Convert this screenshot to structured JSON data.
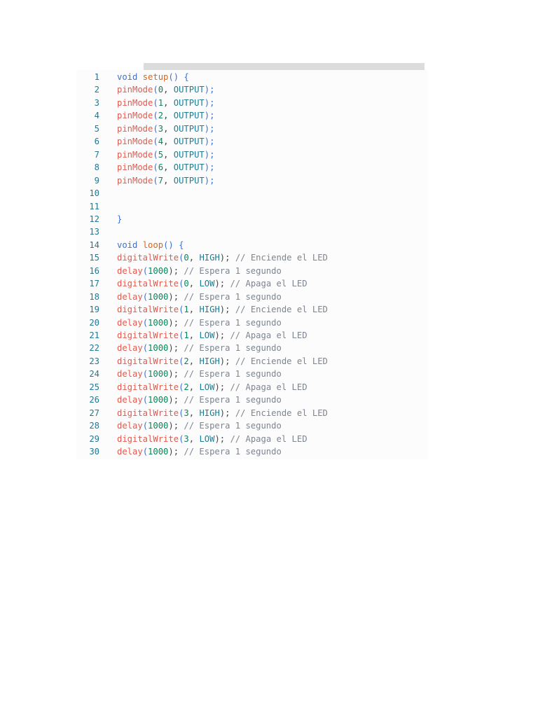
{
  "code": {
    "lines": [
      {
        "n": "1",
        "tokens": [
          {
            "t": "void",
            "c": "kw"
          },
          {
            "t": " ",
            "c": "plain"
          },
          {
            "t": "setup",
            "c": "fn"
          },
          {
            "t": "() {",
            "c": "punc"
          }
        ]
      },
      {
        "n": "2",
        "tokens": [
          {
            "t": "pinMode",
            "c": "err"
          },
          {
            "t": "(",
            "c": "punc"
          },
          {
            "t": "0",
            "c": "num"
          },
          {
            "t": ", ",
            "c": "plain"
          },
          {
            "t": "OUTPUT",
            "c": "const"
          },
          {
            "t": ");",
            "c": "punc"
          }
        ]
      },
      {
        "n": "3",
        "tokens": [
          {
            "t": "pinMode",
            "c": "err"
          },
          {
            "t": "(",
            "c": "punc"
          },
          {
            "t": "1",
            "c": "num"
          },
          {
            "t": ", ",
            "c": "plain"
          },
          {
            "t": "OUTPUT",
            "c": "const"
          },
          {
            "t": ");",
            "c": "punc"
          }
        ]
      },
      {
        "n": "4",
        "tokens": [
          {
            "t": "pinMode",
            "c": "err"
          },
          {
            "t": "(",
            "c": "punc"
          },
          {
            "t": "2",
            "c": "num"
          },
          {
            "t": ", ",
            "c": "plain"
          },
          {
            "t": "OUTPUT",
            "c": "const"
          },
          {
            "t": ");",
            "c": "punc"
          }
        ]
      },
      {
        "n": "5",
        "tokens": [
          {
            "t": "pinMode",
            "c": "err"
          },
          {
            "t": "(",
            "c": "punc"
          },
          {
            "t": "3",
            "c": "num"
          },
          {
            "t": ", ",
            "c": "plain"
          },
          {
            "t": "OUTPUT",
            "c": "const"
          },
          {
            "t": ");",
            "c": "punc"
          }
        ]
      },
      {
        "n": "6",
        "tokens": [
          {
            "t": "pinMode",
            "c": "err"
          },
          {
            "t": "(",
            "c": "punc"
          },
          {
            "t": "4",
            "c": "num"
          },
          {
            "t": ", ",
            "c": "plain"
          },
          {
            "t": "OUTPUT",
            "c": "const"
          },
          {
            "t": ");",
            "c": "punc"
          }
        ]
      },
      {
        "n": "7",
        "tokens": [
          {
            "t": "pinMode",
            "c": "err"
          },
          {
            "t": "(",
            "c": "punc"
          },
          {
            "t": "5",
            "c": "num"
          },
          {
            "t": ", ",
            "c": "plain"
          },
          {
            "t": "OUTPUT",
            "c": "const"
          },
          {
            "t": ");",
            "c": "punc"
          }
        ]
      },
      {
        "n": "8",
        "tokens": [
          {
            "t": "pinMode",
            "c": "err"
          },
          {
            "t": "(",
            "c": "punc"
          },
          {
            "t": "6",
            "c": "num"
          },
          {
            "t": ", ",
            "c": "plain"
          },
          {
            "t": "OUTPUT",
            "c": "const"
          },
          {
            "t": ");",
            "c": "punc"
          }
        ]
      },
      {
        "n": "9",
        "tokens": [
          {
            "t": "pinMode",
            "c": "err"
          },
          {
            "t": "(",
            "c": "punc"
          },
          {
            "t": "7",
            "c": "num"
          },
          {
            "t": ", ",
            "c": "plain"
          },
          {
            "t": "OUTPUT",
            "c": "const"
          },
          {
            "t": ");",
            "c": "punc"
          }
        ]
      },
      {
        "n": "10",
        "tokens": []
      },
      {
        "n": "11",
        "tokens": []
      },
      {
        "n": "12",
        "tokens": [
          {
            "t": "}",
            "c": "punc"
          }
        ]
      },
      {
        "n": "13",
        "tokens": []
      },
      {
        "n": "14",
        "tokens": [
          {
            "t": "void",
            "c": "kw"
          },
          {
            "t": " ",
            "c": "plain"
          },
          {
            "t": "loop",
            "c": "fn"
          },
          {
            "t": "() {",
            "c": "punc"
          }
        ]
      },
      {
        "n": "15",
        "tokens": [
          {
            "t": "digitalWrite",
            "c": "err"
          },
          {
            "t": "(",
            "c": "punc"
          },
          {
            "t": "0",
            "c": "num"
          },
          {
            "t": ", ",
            "c": "plain"
          },
          {
            "t": "HIGH",
            "c": "const"
          },
          {
            "t": "); ",
            "c": "plain"
          },
          {
            "t": "// Enciende el LED",
            "c": "com"
          }
        ]
      },
      {
        "n": "16",
        "tokens": [
          {
            "t": "delay",
            "c": "err"
          },
          {
            "t": "(",
            "c": "punc"
          },
          {
            "t": "1000",
            "c": "num"
          },
          {
            "t": "); ",
            "c": "plain"
          },
          {
            "t": "// Espera 1 segundo",
            "c": "com"
          }
        ]
      },
      {
        "n": "17",
        "tokens": [
          {
            "t": "digitalWrite",
            "c": "err"
          },
          {
            "t": "(",
            "c": "punc"
          },
          {
            "t": "0",
            "c": "num"
          },
          {
            "t": ", ",
            "c": "plain"
          },
          {
            "t": "LOW",
            "c": "const"
          },
          {
            "t": "); ",
            "c": "plain"
          },
          {
            "t": "// Apaga el LED",
            "c": "com"
          }
        ]
      },
      {
        "n": "18",
        "tokens": [
          {
            "t": "delay",
            "c": "err"
          },
          {
            "t": "(",
            "c": "punc"
          },
          {
            "t": "1000",
            "c": "num"
          },
          {
            "t": "); ",
            "c": "plain"
          },
          {
            "t": "// Espera 1 segundo",
            "c": "com"
          }
        ]
      },
      {
        "n": "19",
        "tokens": [
          {
            "t": "digitalWrite",
            "c": "err"
          },
          {
            "t": "(",
            "c": "punc"
          },
          {
            "t": "1",
            "c": "num"
          },
          {
            "t": ", ",
            "c": "plain"
          },
          {
            "t": "HIGH",
            "c": "const"
          },
          {
            "t": "); ",
            "c": "plain"
          },
          {
            "t": "// Enciende el LED",
            "c": "com"
          }
        ]
      },
      {
        "n": "20",
        "tokens": [
          {
            "t": "delay",
            "c": "err"
          },
          {
            "t": "(",
            "c": "punc"
          },
          {
            "t": "1000",
            "c": "num"
          },
          {
            "t": "); ",
            "c": "plain"
          },
          {
            "t": "// Espera 1 segundo",
            "c": "com"
          }
        ]
      },
      {
        "n": "21",
        "tokens": [
          {
            "t": "digitalWrite",
            "c": "err"
          },
          {
            "t": "(",
            "c": "punc"
          },
          {
            "t": "1",
            "c": "num"
          },
          {
            "t": ", ",
            "c": "plain"
          },
          {
            "t": "LOW",
            "c": "const"
          },
          {
            "t": "); ",
            "c": "plain"
          },
          {
            "t": "// Apaga el LED",
            "c": "com"
          }
        ]
      },
      {
        "n": "22",
        "tokens": [
          {
            "t": "delay",
            "c": "err"
          },
          {
            "t": "(",
            "c": "punc"
          },
          {
            "t": "1000",
            "c": "num"
          },
          {
            "t": "); ",
            "c": "plain"
          },
          {
            "t": "// Espera 1 segundo",
            "c": "com"
          }
        ]
      },
      {
        "n": "23",
        "tokens": [
          {
            "t": "digitalWrite",
            "c": "err"
          },
          {
            "t": "(",
            "c": "punc"
          },
          {
            "t": "2",
            "c": "num"
          },
          {
            "t": ", ",
            "c": "plain"
          },
          {
            "t": "HIGH",
            "c": "const"
          },
          {
            "t": "); ",
            "c": "plain"
          },
          {
            "t": "// Enciende el LED",
            "c": "com"
          }
        ]
      },
      {
        "n": "24",
        "tokens": [
          {
            "t": "delay",
            "c": "err"
          },
          {
            "t": "(",
            "c": "punc"
          },
          {
            "t": "1000",
            "c": "num"
          },
          {
            "t": "); ",
            "c": "plain"
          },
          {
            "t": "// Espera 1 segundo",
            "c": "com"
          }
        ]
      },
      {
        "n": "25",
        "tokens": [
          {
            "t": "digitalWrite",
            "c": "err"
          },
          {
            "t": "(",
            "c": "punc"
          },
          {
            "t": "2",
            "c": "num"
          },
          {
            "t": ", ",
            "c": "plain"
          },
          {
            "t": "LOW",
            "c": "const"
          },
          {
            "t": "); ",
            "c": "plain"
          },
          {
            "t": "// Apaga el LED",
            "c": "com"
          }
        ]
      },
      {
        "n": "26",
        "tokens": [
          {
            "t": "delay",
            "c": "err"
          },
          {
            "t": "(",
            "c": "punc"
          },
          {
            "t": "1000",
            "c": "num"
          },
          {
            "t": "); ",
            "c": "plain"
          },
          {
            "t": "// Espera 1 segundo",
            "c": "com"
          }
        ]
      },
      {
        "n": "27",
        "tokens": [
          {
            "t": "digitalWrite",
            "c": "err"
          },
          {
            "t": "(",
            "c": "punc"
          },
          {
            "t": "3",
            "c": "num"
          },
          {
            "t": ", ",
            "c": "plain"
          },
          {
            "t": "HIGH",
            "c": "const"
          },
          {
            "t": "); ",
            "c": "plain"
          },
          {
            "t": "// Enciende el LED",
            "c": "com"
          }
        ]
      },
      {
        "n": "28",
        "tokens": [
          {
            "t": "delay",
            "c": "err"
          },
          {
            "t": "(",
            "c": "punc"
          },
          {
            "t": "1000",
            "c": "num"
          },
          {
            "t": "); ",
            "c": "plain"
          },
          {
            "t": "// Espera 1 segundo",
            "c": "com"
          }
        ]
      },
      {
        "n": "29",
        "tokens": [
          {
            "t": "digitalWrite",
            "c": "err"
          },
          {
            "t": "(",
            "c": "punc"
          },
          {
            "t": "3",
            "c": "num"
          },
          {
            "t": ", ",
            "c": "plain"
          },
          {
            "t": "LOW",
            "c": "const"
          },
          {
            "t": "); ",
            "c": "plain"
          },
          {
            "t": "// Apaga el LED",
            "c": "com"
          }
        ]
      },
      {
        "n": "30",
        "tokens": [
          {
            "t": "delay",
            "c": "err"
          },
          {
            "t": "(",
            "c": "punc"
          },
          {
            "t": "1000",
            "c": "num"
          },
          {
            "t": "); ",
            "c": "plain"
          },
          {
            "t": "// Espera 1 segundo",
            "c": "com"
          }
        ]
      }
    ]
  }
}
